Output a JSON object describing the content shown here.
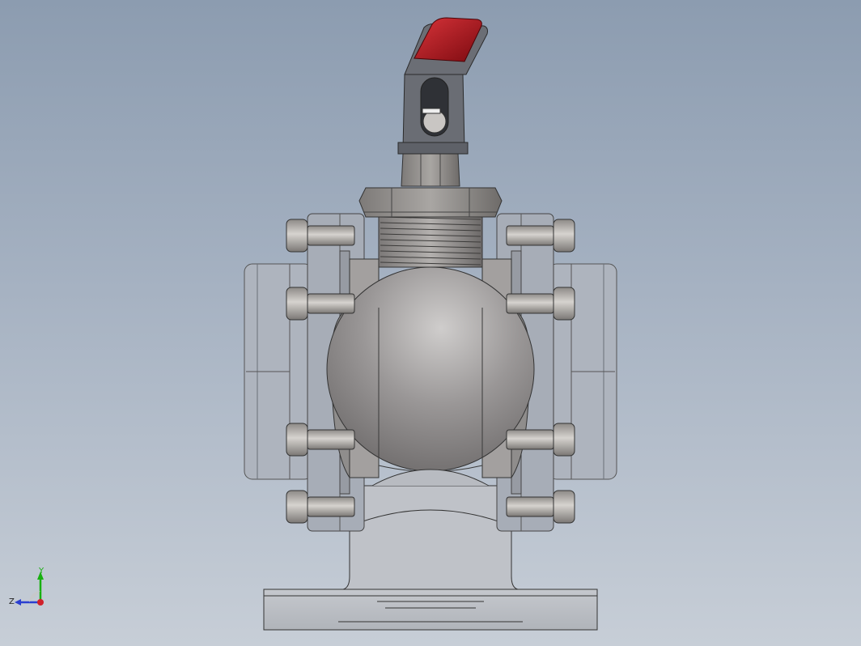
{
  "viewport": {
    "background_top": "#8c9cb0",
    "background_bottom": "#c7ced7"
  },
  "model": {
    "body_color": "#9c9a9a",
    "ball_color": "#8f8c8b",
    "flange_color": "#a7adb7",
    "handle_grip_color": "#b3121a",
    "bolt_color": "#b5b2ae"
  },
  "triad": {
    "y_label": "Y",
    "z_label": "Z",
    "y_color": "#18b010",
    "z_color": "#2a3fd0",
    "x_color": "#d0202a"
  }
}
